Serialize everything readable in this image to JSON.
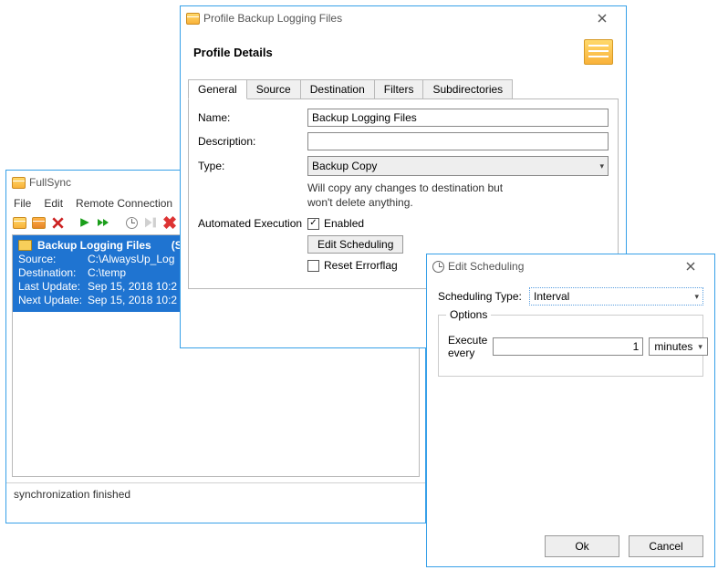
{
  "main": {
    "title": "FullSync",
    "menu": {
      "file": "File",
      "edit": "Edit",
      "remote": "Remote Connection"
    },
    "status": "synchronization finished",
    "profile": {
      "name": "Backup Logging Files",
      "suffix": "(Se",
      "source_k": "Source:",
      "source_v": "C:\\AlwaysUp_Log",
      "dest_k": "Destination:",
      "dest_v": "C:\\temp",
      "last_k": "Last Update:",
      "last_v": "Sep 15, 2018 10:2",
      "next_k": "Next Update:",
      "next_v": "Sep 15, 2018 10:2"
    }
  },
  "profileDialog": {
    "title": "Profile Backup Logging Files",
    "section": "Profile Details",
    "tabs": {
      "general": "General",
      "source": "Source",
      "destination": "Destination",
      "filters": "Filters",
      "subdirs": "Subdirectories"
    },
    "labels": {
      "name": "Name:",
      "description": "Description:",
      "type": "Type:",
      "autoexec": "Automated Execution"
    },
    "values": {
      "name": "Backup Logging Files",
      "description": "",
      "type": "Backup Copy"
    },
    "typeDesc1": "Will copy any changes to destination but",
    "typeDesc2": "won't delete anything.",
    "enabled": "Enabled",
    "editScheduling": "Edit Scheduling",
    "resetError": "Reset Errorflag"
  },
  "schedDialog": {
    "title": "Edit Scheduling",
    "typeLabel": "Scheduling Type:",
    "typeValue": "Interval",
    "options": "Options",
    "executeEvery": "Execute every",
    "value": "1",
    "unit": "minutes",
    "ok": "Ok",
    "cancel": "Cancel"
  }
}
